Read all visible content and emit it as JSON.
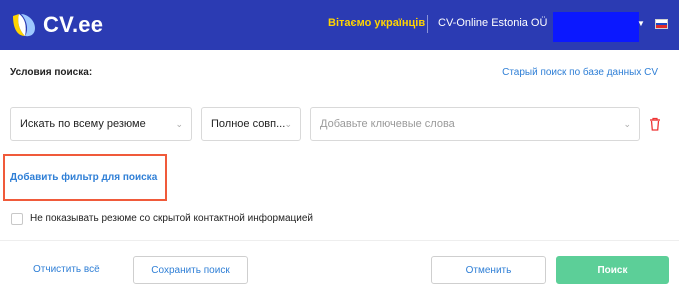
{
  "header": {
    "logo_text": "CV.ee",
    "welcome": "Вітаємо українців",
    "company": "CV-Online Estonia OÜ",
    "colors": {
      "background": "#2b3bb3",
      "welcome": "#ffd400",
      "user_box": "#0b18ff"
    }
  },
  "conditions": {
    "label": "Условия поиска:",
    "old_search_link": "Старый поиск по базе данных CV"
  },
  "search_row": {
    "scope_select": "Искать по всему резюме",
    "match_select": "Полное совп...",
    "keywords_placeholder": "Добавьте ключевые слова"
  },
  "filter": {
    "add_filter_link": "Добавить фильтр для поиска",
    "highlight_color": "#f05a3a"
  },
  "options": {
    "hide_hidden_contacts": "Не показывать резюме со скрытой контактной информацией",
    "hide_hidden_contacts_checked": false
  },
  "footer": {
    "clear_all": "Отчистить всё",
    "save_search": "Сохранить поиск",
    "cancel": "Отменить",
    "search": "Поиск",
    "search_color": "#5ccf98"
  },
  "icons": [
    "logo-mark-icon",
    "chevron-down-icon",
    "russian-flag-icon",
    "trash-icon"
  ]
}
